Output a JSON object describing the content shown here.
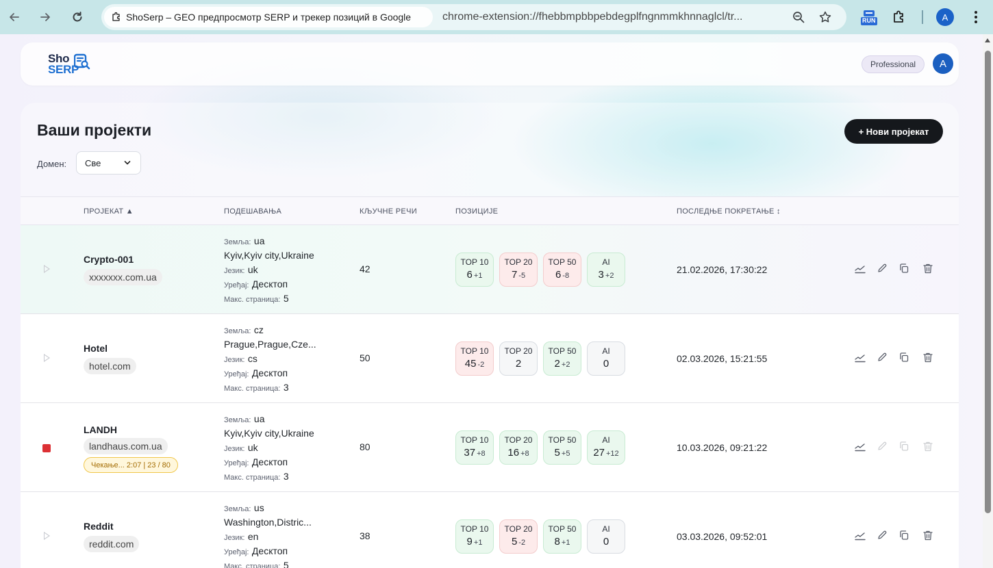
{
  "browser": {
    "tab_title": "ShoSerp – GEO предпросмотр SERP и трекер позиций в Google",
    "url": "chrome-extension://fhebbmpbbpebdegplfngnmmkhnnaglcl/tr...",
    "run_label": "RUN",
    "profile_initial": "A"
  },
  "app": {
    "logo_top": "Sho",
    "logo_bottom": "SERP",
    "plan": "Professional",
    "user_initial": "A"
  },
  "projects_page": {
    "title": "Ваши пројекти",
    "new_project_label": "+ Нови пројекат",
    "domain_filter_label": "Домен:",
    "domain_filter_value": "Све"
  },
  "table": {
    "headers": {
      "project": "ПРОЈЕКАТ ▲",
      "settings": "ПОДЕШАВАЊА",
      "keywords": "КЉУЧНЕ РЕЧИ",
      "positions": "ПОЗИЦИЈЕ",
      "last_run": "ПОСЛЕДЊЕ ПОКРЕТАЊЕ ↕"
    },
    "setting_labels": {
      "country": "Земља:",
      "language": "Језик:",
      "device": "Уређај:",
      "max_pages": "Макс. страница:"
    },
    "rows": [
      {
        "name": "Crypto-001",
        "domain": "xxxxxxx.com.ua",
        "status": "idle",
        "country": "ua",
        "location": "Kyiv,Kyiv city,Ukraine",
        "language": "uk",
        "device": "Десктоп",
        "max_pages": "5",
        "keywords": "42",
        "positions": [
          {
            "label": "TOP 10",
            "value": "6",
            "delta": "+1",
            "trend": "up"
          },
          {
            "label": "TOP 20",
            "value": "7",
            "delta": "-5",
            "trend": "down"
          },
          {
            "label": "TOP 50",
            "value": "6",
            "delta": "-8",
            "trend": "down"
          },
          {
            "label": "AI",
            "value": "3",
            "delta": "+2",
            "trend": "up"
          }
        ],
        "last_run": "21.02.2026, 17:30:22"
      },
      {
        "name": "Hotel",
        "domain": "hotel.com",
        "status": "idle",
        "country": "cz",
        "location": "Prague,Prague,Cze...",
        "language": "cs",
        "device": "Десктоп",
        "max_pages": "3",
        "keywords": "50",
        "positions": [
          {
            "label": "TOP 10",
            "value": "45",
            "delta": "-2",
            "trend": "down"
          },
          {
            "label": "TOP 20",
            "value": "2",
            "delta": "",
            "trend": "neutral"
          },
          {
            "label": "TOP 50",
            "value": "2",
            "delta": "+2",
            "trend": "up"
          },
          {
            "label": "AI",
            "value": "0",
            "delta": "",
            "trend": "neutral"
          }
        ],
        "last_run": "02.03.2026, 15:21:55"
      },
      {
        "name": "LANDH",
        "domain": "landhaus.com.ua",
        "status": "running",
        "wait_text": "Чекање... 2:07  |  23 / 80",
        "country": "ua",
        "location": "Kyiv,Kyiv city,Ukraine",
        "language": "uk",
        "device": "Десктоп",
        "max_pages": "3",
        "keywords": "80",
        "positions": [
          {
            "label": "TOP 10",
            "value": "37",
            "delta": "+8",
            "trend": "up"
          },
          {
            "label": "TOP 20",
            "value": "16",
            "delta": "+8",
            "trend": "up"
          },
          {
            "label": "TOP 50",
            "value": "5",
            "delta": "+5",
            "trend": "up"
          },
          {
            "label": "AI",
            "value": "27",
            "delta": "+12",
            "trend": "up"
          }
        ],
        "last_run": "10.03.2026, 09:21:22"
      },
      {
        "name": "Reddit",
        "domain": "reddit.com",
        "status": "idle",
        "country": "us",
        "location": "Washington,Distric...",
        "language": "en",
        "device": "Десктоп",
        "max_pages": "5",
        "keywords": "38",
        "positions": [
          {
            "label": "TOP 10",
            "value": "9",
            "delta": "+1",
            "trend": "up"
          },
          {
            "label": "TOP 20",
            "value": "5",
            "delta": "-2",
            "trend": "down"
          },
          {
            "label": "TOP 50",
            "value": "8",
            "delta": "+1",
            "trend": "up"
          },
          {
            "label": "AI",
            "value": "0",
            "delta": "",
            "trend": "neutral"
          }
        ],
        "last_run": "03.03.2026, 09:52:01"
      }
    ]
  },
  "colors": {
    "up_bg": "#eaf8ee",
    "down_bg": "#fdebeb",
    "running_stop": "#dc3034",
    "primary_button": "#15181c"
  }
}
